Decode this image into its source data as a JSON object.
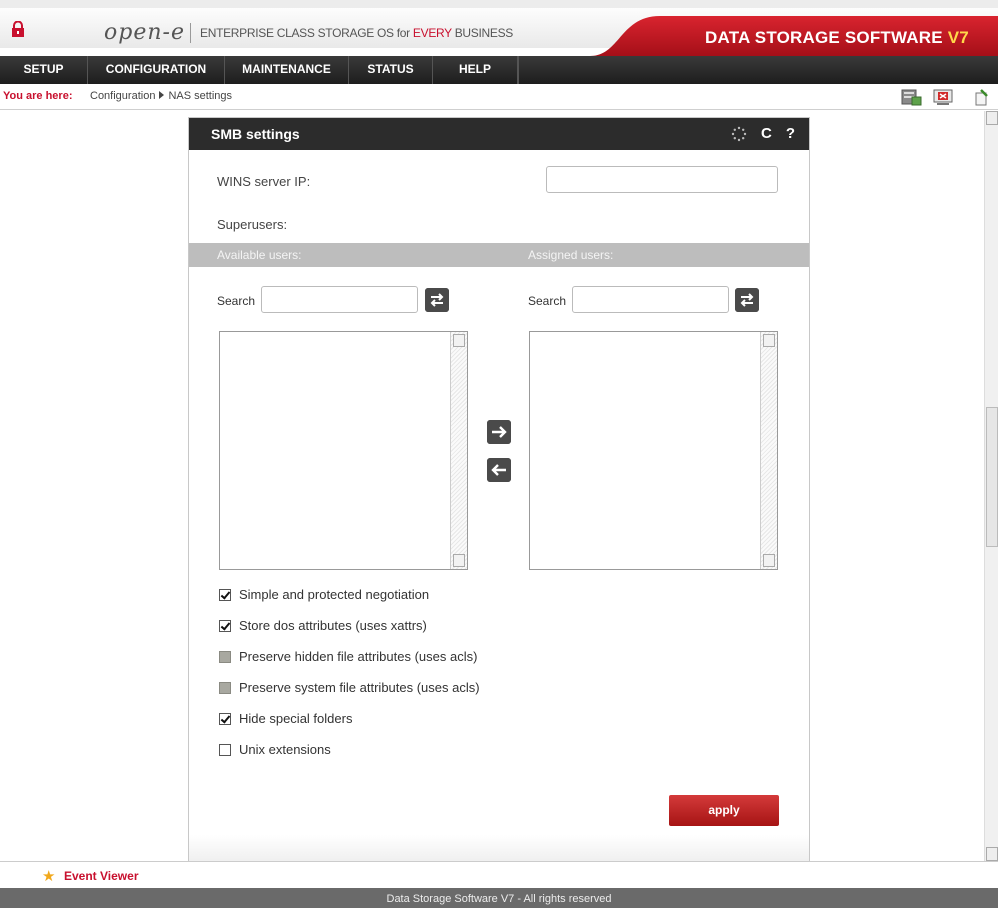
{
  "header": {
    "logo": "open-e",
    "tagline_prefix": "ENTERPRISE CLASS STORAGE OS for ",
    "tagline_highlight": "EVERY",
    "tagline_suffix": " BUSINESS",
    "brand_title": "DATA STORAGE SOFTWARE ",
    "brand_version": "V7",
    "brand_color": "#c8102e"
  },
  "nav": {
    "items": [
      "SETUP",
      "CONFIGURATION",
      "MAINTENANCE",
      "STATUS",
      "HELP"
    ]
  },
  "breadcrumb": {
    "label": "You are here:",
    "items": [
      "Configuration",
      "NAS settings"
    ]
  },
  "panel": {
    "title": "SMB settings",
    "refresh_icon": "C",
    "help_icon": "?",
    "wins_label": "WINS server IP:",
    "wins_value": "",
    "superusers_label": "Superusers:",
    "available_users_label": "Available users:",
    "assigned_users_label": "Assigned users:",
    "search_label": "Search",
    "options": [
      {
        "label": "Simple and protected negotiation",
        "checked": true,
        "disabled": false
      },
      {
        "label": "Store dos attributes (uses xattrs)",
        "checked": true,
        "disabled": false
      },
      {
        "label": "Preserve hidden file attributes (uses acls)",
        "checked": false,
        "disabled": true
      },
      {
        "label": "Preserve system file attributes (uses acls)",
        "checked": false,
        "disabled": true
      },
      {
        "label": "Hide special folders",
        "checked": true,
        "disabled": false
      },
      {
        "label": "Unix extensions",
        "checked": false,
        "disabled": false
      }
    ],
    "apply_label": "apply"
  },
  "event_viewer": {
    "label": "Event Viewer"
  },
  "footer": {
    "text": "Data Storage Software V7 - All rights reserved"
  }
}
